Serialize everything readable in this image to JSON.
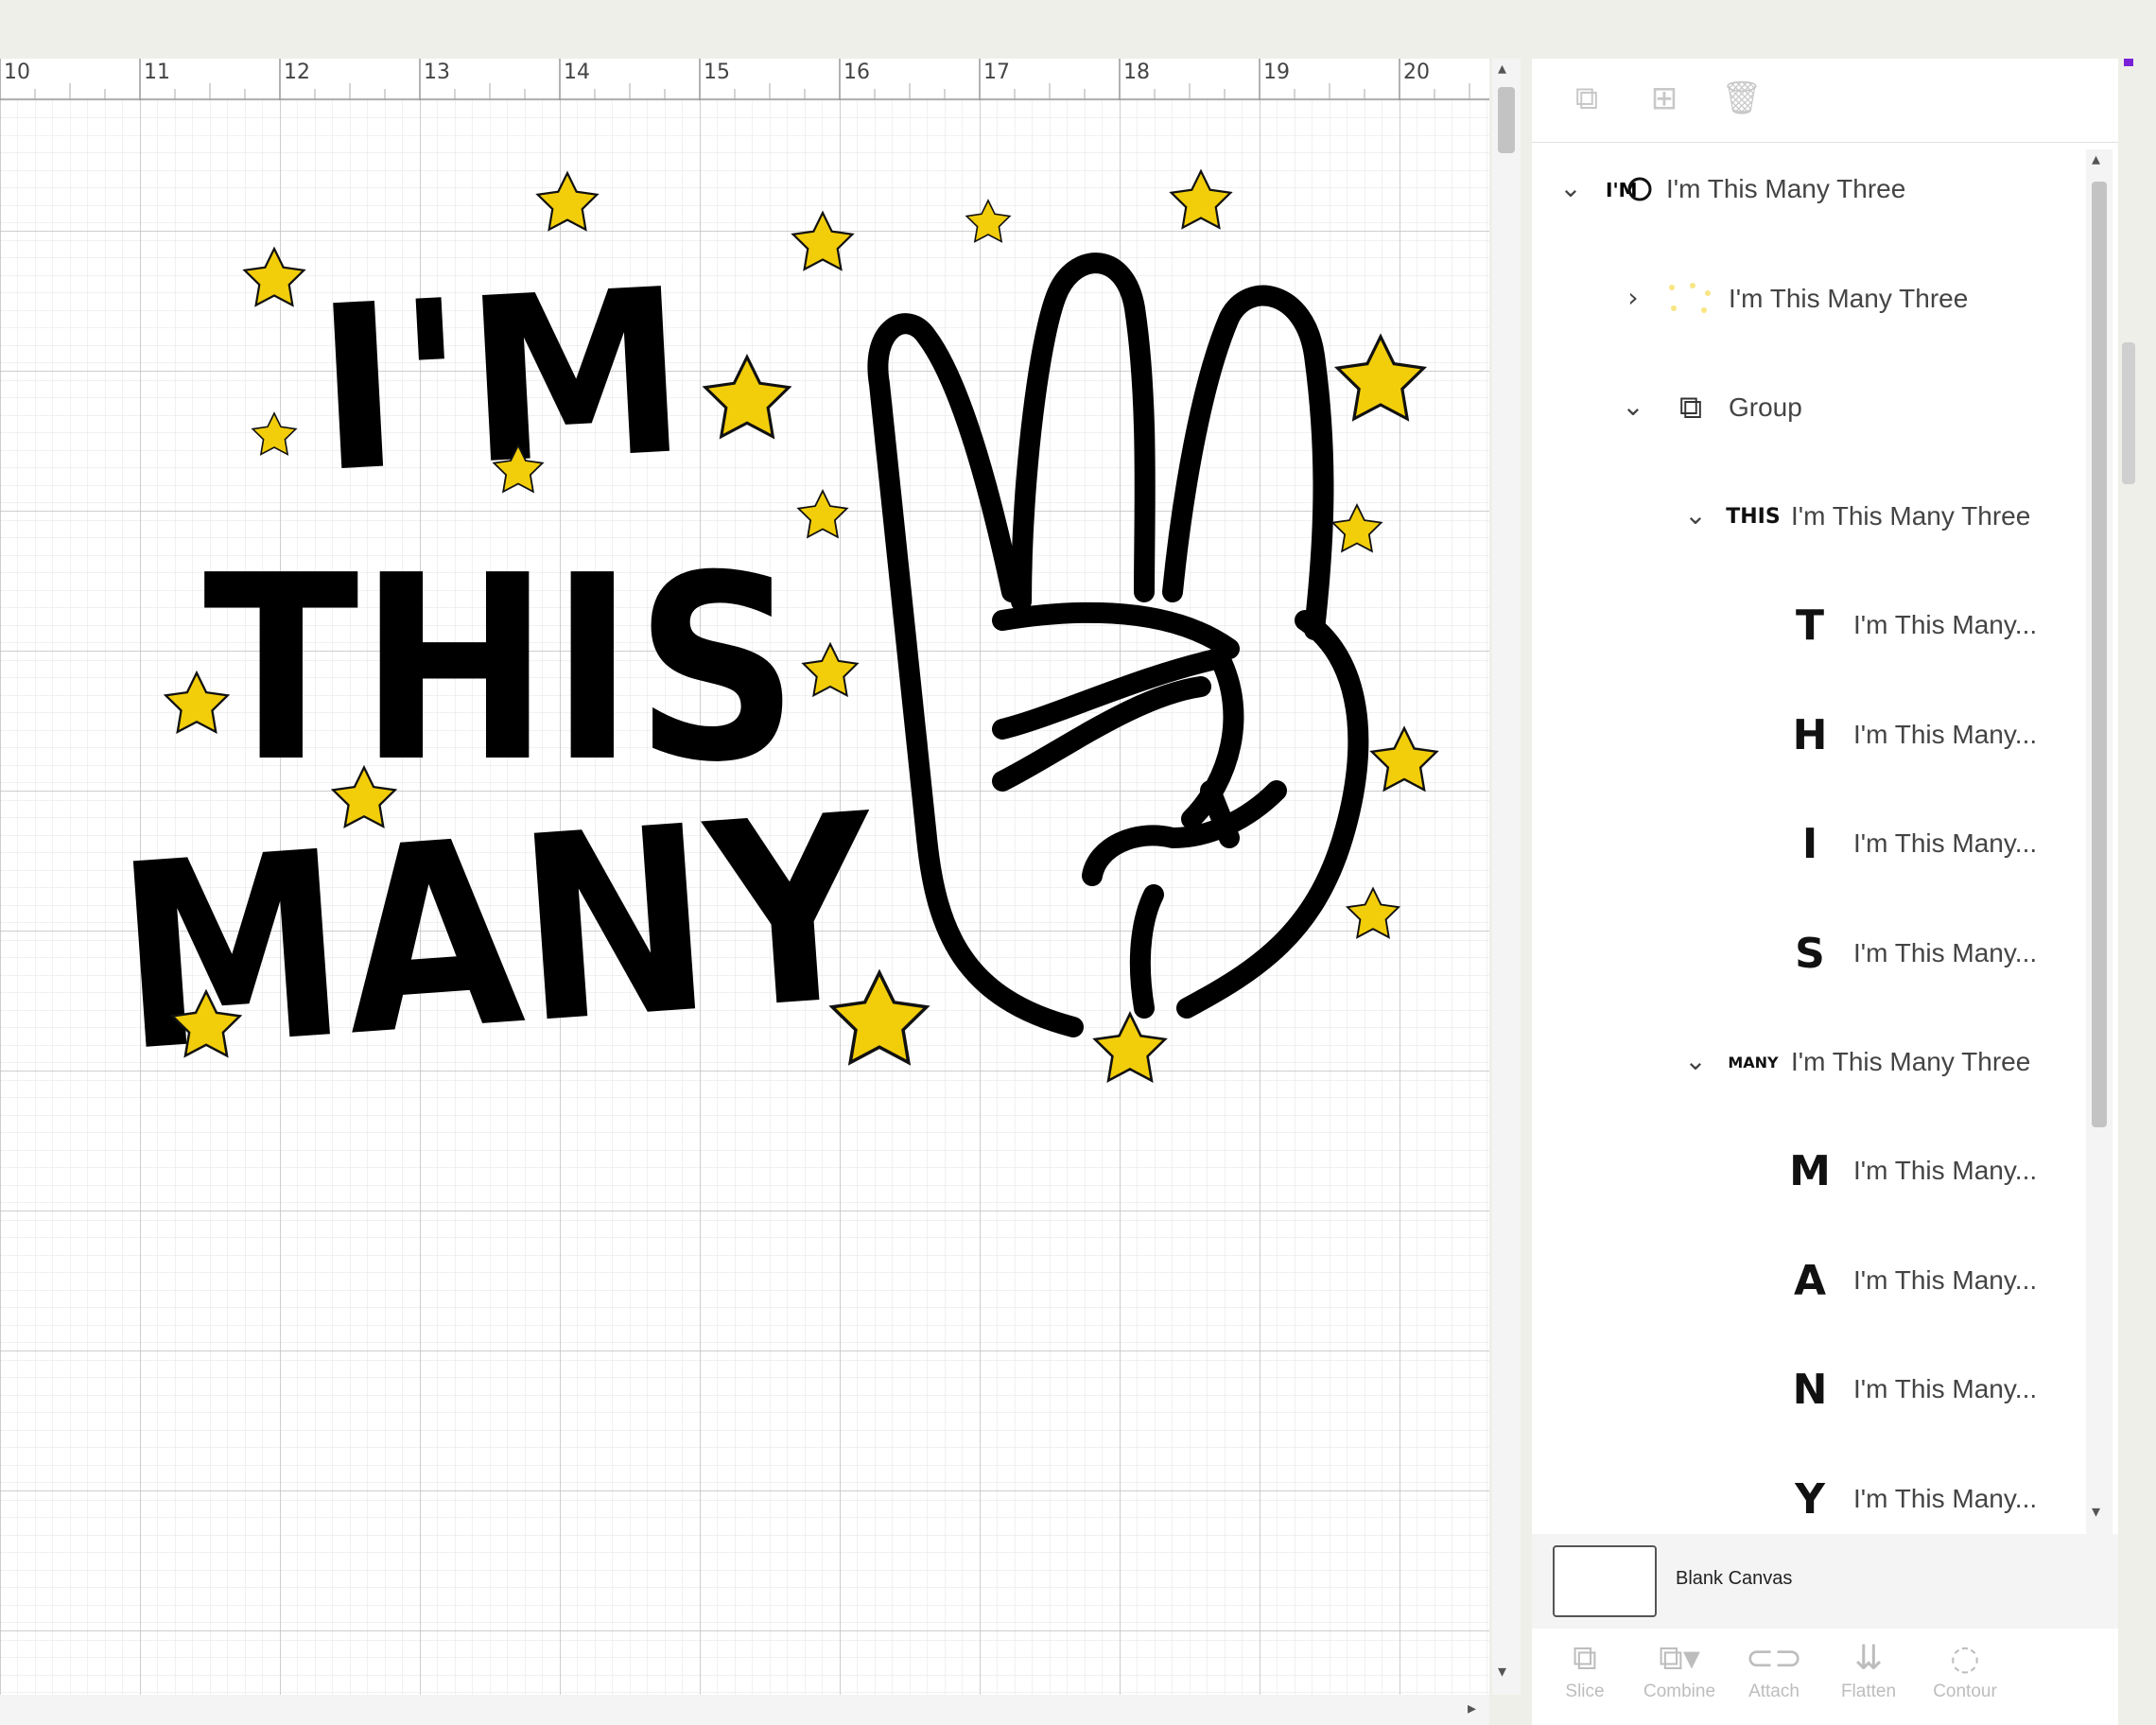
{
  "ruler": {
    "marks": [
      "10",
      "11",
      "12",
      "13",
      "14",
      "15",
      "16",
      "17",
      "18",
      "19",
      "20"
    ]
  },
  "artwork": {
    "line1": "I'M",
    "line2": "THIS",
    "line3": "MANY",
    "star_color": "#f2cd0a",
    "ink_color": "#000000"
  },
  "panel": {
    "tools": {
      "group_icon": "group-icon",
      "duplicate_icon": "duplicate-icon",
      "delete_icon": "trash-icon"
    },
    "layers": [
      {
        "label": "I'm This Many Three",
        "thumb": "",
        "chevron": "⌄"
      },
      {
        "label": "I'm This Many Three",
        "thumb": "",
        "chevron": "›"
      },
      {
        "label": "Group",
        "thumb": "",
        "chevron": "⌄"
      },
      {
        "label": "I'm This Many Three",
        "thumb": "THIS",
        "chevron": "⌄"
      },
      {
        "label": "I'm This Many...",
        "thumb": "T",
        "chevron": ""
      },
      {
        "label": "I'm This Many...",
        "thumb": "H",
        "chevron": ""
      },
      {
        "label": "I'm This Many...",
        "thumb": "I",
        "chevron": ""
      },
      {
        "label": "I'm This Many...",
        "thumb": "S",
        "chevron": ""
      },
      {
        "label": "I'm This Many Three",
        "thumb": "MANY",
        "chevron": "⌄"
      },
      {
        "label": "I'm This Many...",
        "thumb": "M",
        "chevron": ""
      },
      {
        "label": "I'm This Many...",
        "thumb": "A",
        "chevron": ""
      },
      {
        "label": "I'm This Many...",
        "thumb": "N",
        "chevron": ""
      },
      {
        "label": "I'm This Many...",
        "thumb": "Y",
        "chevron": ""
      }
    ],
    "blank_canvas_label": "Blank Canvas",
    "bottom_tools": [
      {
        "label": "Slice",
        "icon": "slice-icon"
      },
      {
        "label": "Combine",
        "icon": "combine-icon"
      },
      {
        "label": "Attach",
        "icon": "attach-icon"
      },
      {
        "label": "Flatten",
        "icon": "flatten-icon"
      },
      {
        "label": "Contour",
        "icon": "contour-icon"
      }
    ]
  },
  "colors": {
    "accent": "#7a22d8",
    "star": "#f2cd0a"
  }
}
